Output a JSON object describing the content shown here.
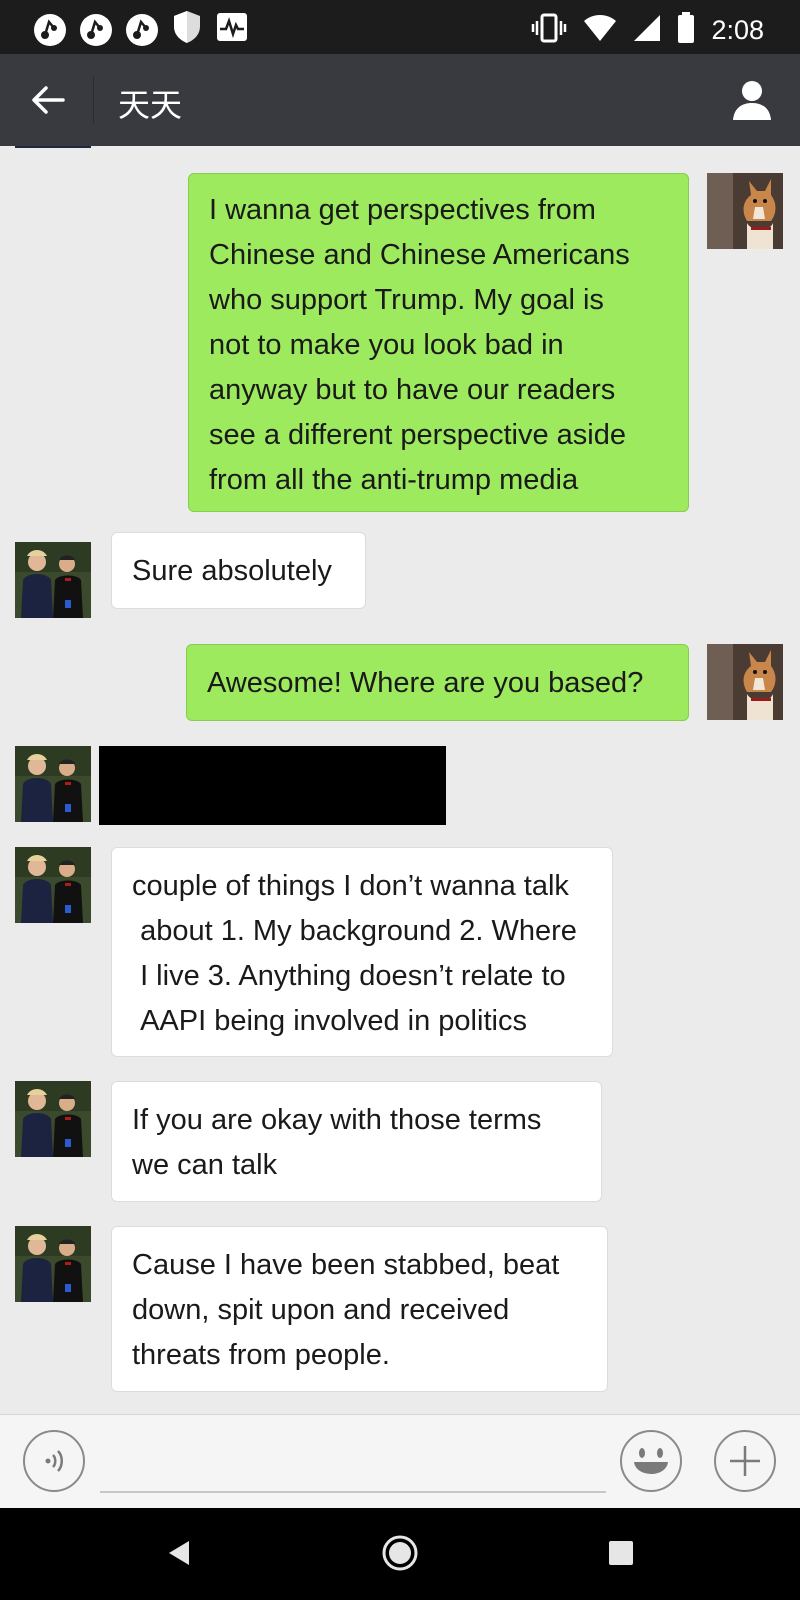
{
  "status_bar": {
    "time": "2:08",
    "left_icons": [
      "notification-icon",
      "notification-icon",
      "notification-icon",
      "shield-icon",
      "activity-icon"
    ],
    "right_icons": [
      "vibrate-icon",
      "wifi-icon",
      "signal-icon",
      "battery-icon"
    ]
  },
  "header": {
    "title": "天天",
    "back_icon": "arrow-left-icon",
    "profile_icon": "person-icon"
  },
  "messages": [
    {
      "sender": "me",
      "text": "I wanna get perspectives from\nChinese and Chinese Americans\nwho support Trump. My goal is\nnot to make you look bad in\nanyway but to have our readers\nsee a different perspective aside\nfrom all the anti-trump media"
    },
    {
      "sender": "them",
      "text": "Sure absolutely"
    },
    {
      "sender": "me",
      "text": "Awesome! Where are you based?"
    },
    {
      "sender": "them",
      "redacted": true
    },
    {
      "sender": "them",
      "text": "couple of things I don’t wanna talk\n about 1. My background 2. Where\n I live 3. Anything doesn’t relate to\n AAPI being involved in politics"
    },
    {
      "sender": "them",
      "text": "If you are okay with those terms\nwe can talk"
    },
    {
      "sender": "them",
      "text": "Cause I have been stabbed, beat\ndown, spit upon and received\nthreats from people."
    }
  ],
  "input_bar": {
    "voice_icon": "voice-icon",
    "emoji_icon": "emoji-icon",
    "plus_icon": "plus-icon"
  },
  "nav_bar": {
    "icons": [
      "nav-back-icon",
      "nav-home-icon",
      "nav-recents-icon"
    ]
  },
  "colors": {
    "outgoing_bubble": "#9eea5e",
    "incoming_bubble": "#ffffff",
    "chat_background": "#ebebeb",
    "header_background": "#383a3f"
  }
}
